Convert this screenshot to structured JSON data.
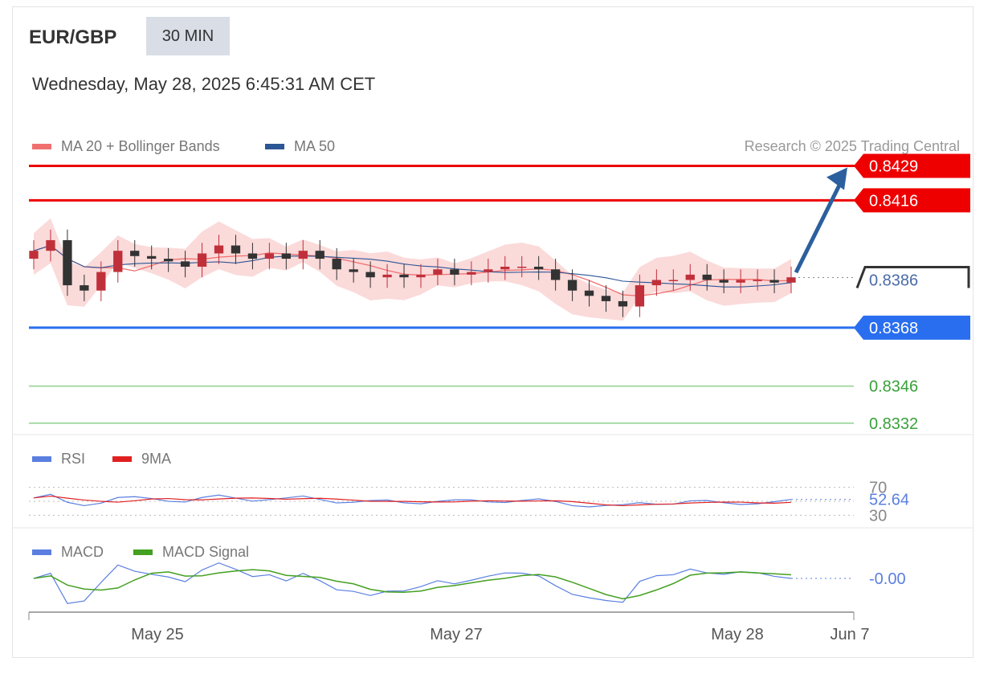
{
  "header": {
    "pair": "EUR/GBP",
    "timeframe": "30 MIN",
    "datetime": "Wednesday, May 28, 2025 6:45:31 AM CET",
    "copyright": "Research © 2025 Trading Central"
  },
  "legend": {
    "ma20": "MA 20 + Bollinger Bands",
    "ma50": "MA 50",
    "rsi": "RSI",
    "rsi_ma": "9MA",
    "macd": "MACD",
    "macd_signal": "MACD Signal"
  },
  "colors": {
    "resistance": "#ee0000",
    "support": "#2a6ef0",
    "target": "#3aa03a",
    "ma20": "#f07070",
    "ma50": "#2c5596",
    "band": "#fbdada",
    "candle_up": "#c0303a",
    "candle_down": "#333333",
    "rsi": "#5a7fe0",
    "rsi_ma": "#e02020",
    "macd": "#5a7fe0",
    "macd_signal": "#44a020",
    "arrow": "#2c5f9e"
  },
  "chart_data": [
    {
      "type": "candlestick",
      "pair": "EUR/GBP",
      "timeframe": "30 MIN",
      "x_ticks": [
        "May 25",
        "May 27",
        "May 28",
        "Jun 7"
      ],
      "ylim": [
        0.8328,
        0.8434
      ],
      "levels": [
        {
          "value": 0.8429,
          "label": "0.8429",
          "role": "resistance"
        },
        {
          "value": 0.8416,
          "label": "0.8416",
          "role": "resistance"
        },
        {
          "value": 0.8386,
          "label": "0.8386",
          "role": "current"
        },
        {
          "value": 0.8368,
          "label": "0.8368",
          "role": "support"
        },
        {
          "value": 0.8346,
          "label": "0.8346",
          "role": "target"
        },
        {
          "value": 0.8332,
          "label": "0.8332",
          "role": "target"
        }
      ],
      "close_series_approx": [
        0.8397,
        0.8401,
        0.8384,
        0.8382,
        0.8389,
        0.8397,
        0.8395,
        0.8394,
        0.8393,
        0.8391,
        0.8396,
        0.8399,
        0.8396,
        0.8394,
        0.8396,
        0.8394,
        0.8397,
        0.8394,
        0.839,
        0.8389,
        0.8387,
        0.8388,
        0.8387,
        0.8388,
        0.839,
        0.8388,
        0.8389,
        0.839,
        0.8391,
        0.8391,
        0.839,
        0.8386,
        0.8382,
        0.838,
        0.8378,
        0.8376,
        0.8384,
        0.8386,
        0.8386,
        0.8388,
        0.8386,
        0.8385,
        0.8386,
        0.8386,
        0.8385,
        0.8387
      ],
      "forecast_target": 0.8429
    },
    {
      "type": "line",
      "name": "RSI",
      "levels": [
        70,
        30
      ],
      "current_value": 52.64,
      "current_label": "52.64"
    },
    {
      "type": "line",
      "name": "MACD",
      "current_value": -0.0,
      "current_label": "-0.00"
    }
  ]
}
